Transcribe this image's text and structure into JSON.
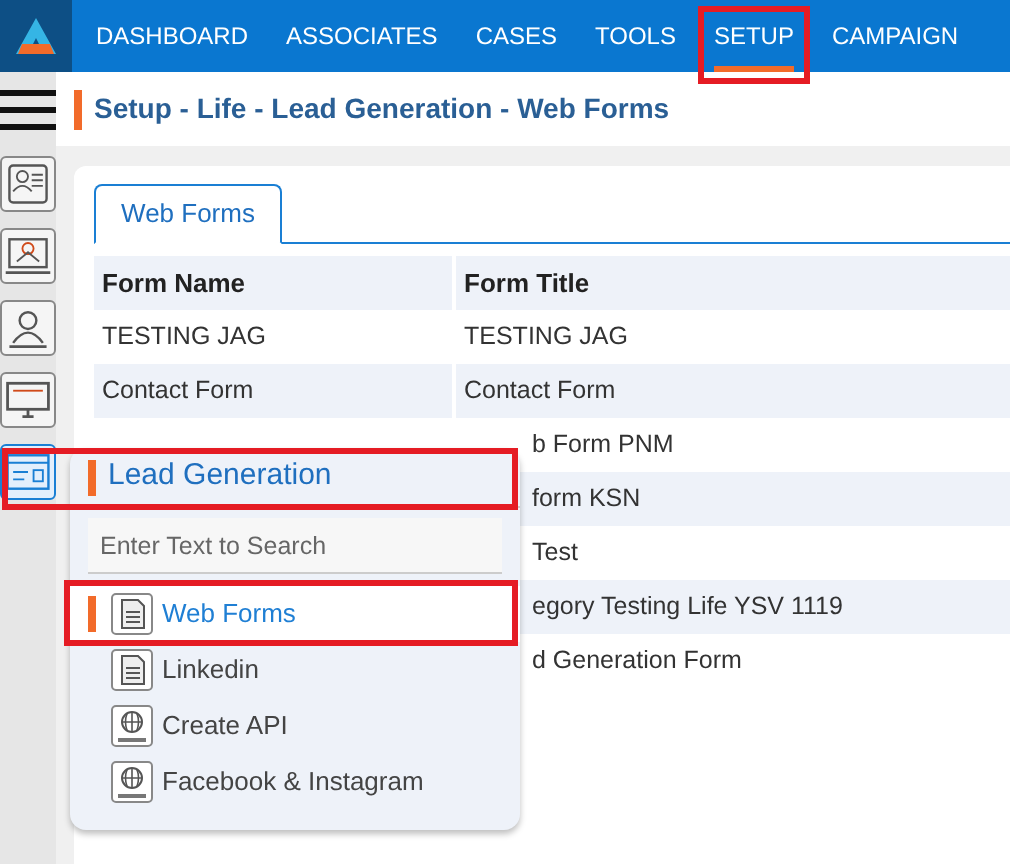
{
  "nav": {
    "items": [
      {
        "label": "DASHBOARD",
        "selected": false
      },
      {
        "label": "ASSOCIATES",
        "selected": false
      },
      {
        "label": "CASES",
        "selected": false
      },
      {
        "label": "TOOLS",
        "selected": false
      },
      {
        "label": "SETUP",
        "selected": true
      },
      {
        "label": "CAMPAIGN",
        "selected": false
      }
    ]
  },
  "breadcrumb": "Setup - Life - Lead Generation - Web Forms",
  "sidebar": {
    "items": [
      {
        "kind": "profile",
        "selected": false
      },
      {
        "kind": "network",
        "selected": false
      },
      {
        "kind": "user",
        "selected": false
      },
      {
        "kind": "monitor",
        "selected": false
      },
      {
        "kind": "form",
        "selected": true
      }
    ]
  },
  "tabs": [
    {
      "label": "Web Forms",
      "selected": true
    }
  ],
  "table": {
    "columns": [
      "Form Name",
      "Form Title"
    ],
    "rows": [
      [
        "TESTING JAG",
        "TESTING JAG"
      ],
      [
        "Contact Form",
        "Contact Form"
      ],
      [
        "",
        "b Form PNM"
      ],
      [
        "",
        "form KSN"
      ],
      [
        "",
        "Test"
      ],
      [
        "",
        "egory Testing Life YSV 1119"
      ],
      [
        "",
        "d Generation Form"
      ]
    ]
  },
  "popup": {
    "title": "Lead Generation",
    "search": {
      "placeholder": "Enter Text to Search"
    },
    "items": [
      {
        "label": "Web Forms",
        "kind": "document",
        "selected": true
      },
      {
        "label": "Linkedin",
        "kind": "document",
        "selected": false
      },
      {
        "label": "Create API",
        "kind": "globe",
        "selected": false
      },
      {
        "label": "Facebook & Instagram",
        "kind": "globe",
        "selected": false
      }
    ]
  }
}
